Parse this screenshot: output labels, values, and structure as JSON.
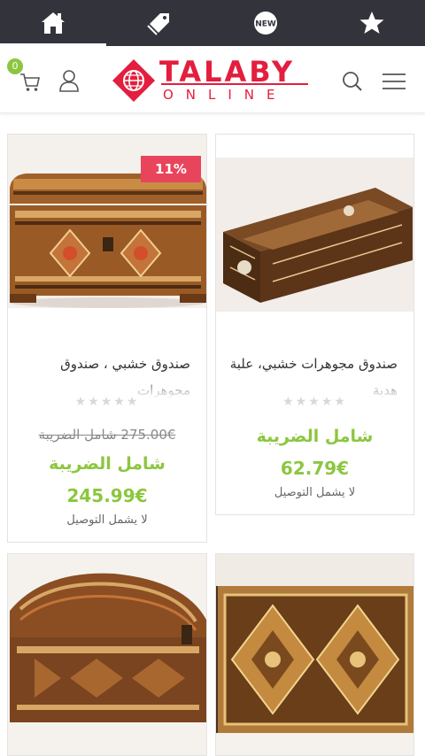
{
  "tabbar": {
    "tabs": [
      {
        "name": "home",
        "icon": "home-icon"
      },
      {
        "name": "tags",
        "icon": "tag-icon"
      },
      {
        "name": "new",
        "icon": "new-badge-icon",
        "label": "NEW"
      },
      {
        "name": "favorites",
        "icon": "star-icon"
      }
    ]
  },
  "header": {
    "cart_count": "0",
    "logo_text": "TALABY",
    "logo_sub": "ONLINE"
  },
  "products": [
    {
      "title": "صندوق خشبي ، صندوق مجوهرات",
      "old_price": "275.00€ شامل الضريبة",
      "tax_label": "شامل الضريبة",
      "price": "245.99€",
      "shipping": "لا يشمل التوصيل",
      "discount": "11%"
    },
    {
      "title": "صندوق مجوهرات خشبي، علبة هدية",
      "tax_label": "شامل الضريبة",
      "price": "62.79€",
      "shipping": "لا يشمل التوصيل"
    }
  ],
  "colors": {
    "tabbar_bg": "#32333b",
    "brand_red": "#e31e3e",
    "price_green": "#8cc63f",
    "badge_red": "#e8455c"
  }
}
